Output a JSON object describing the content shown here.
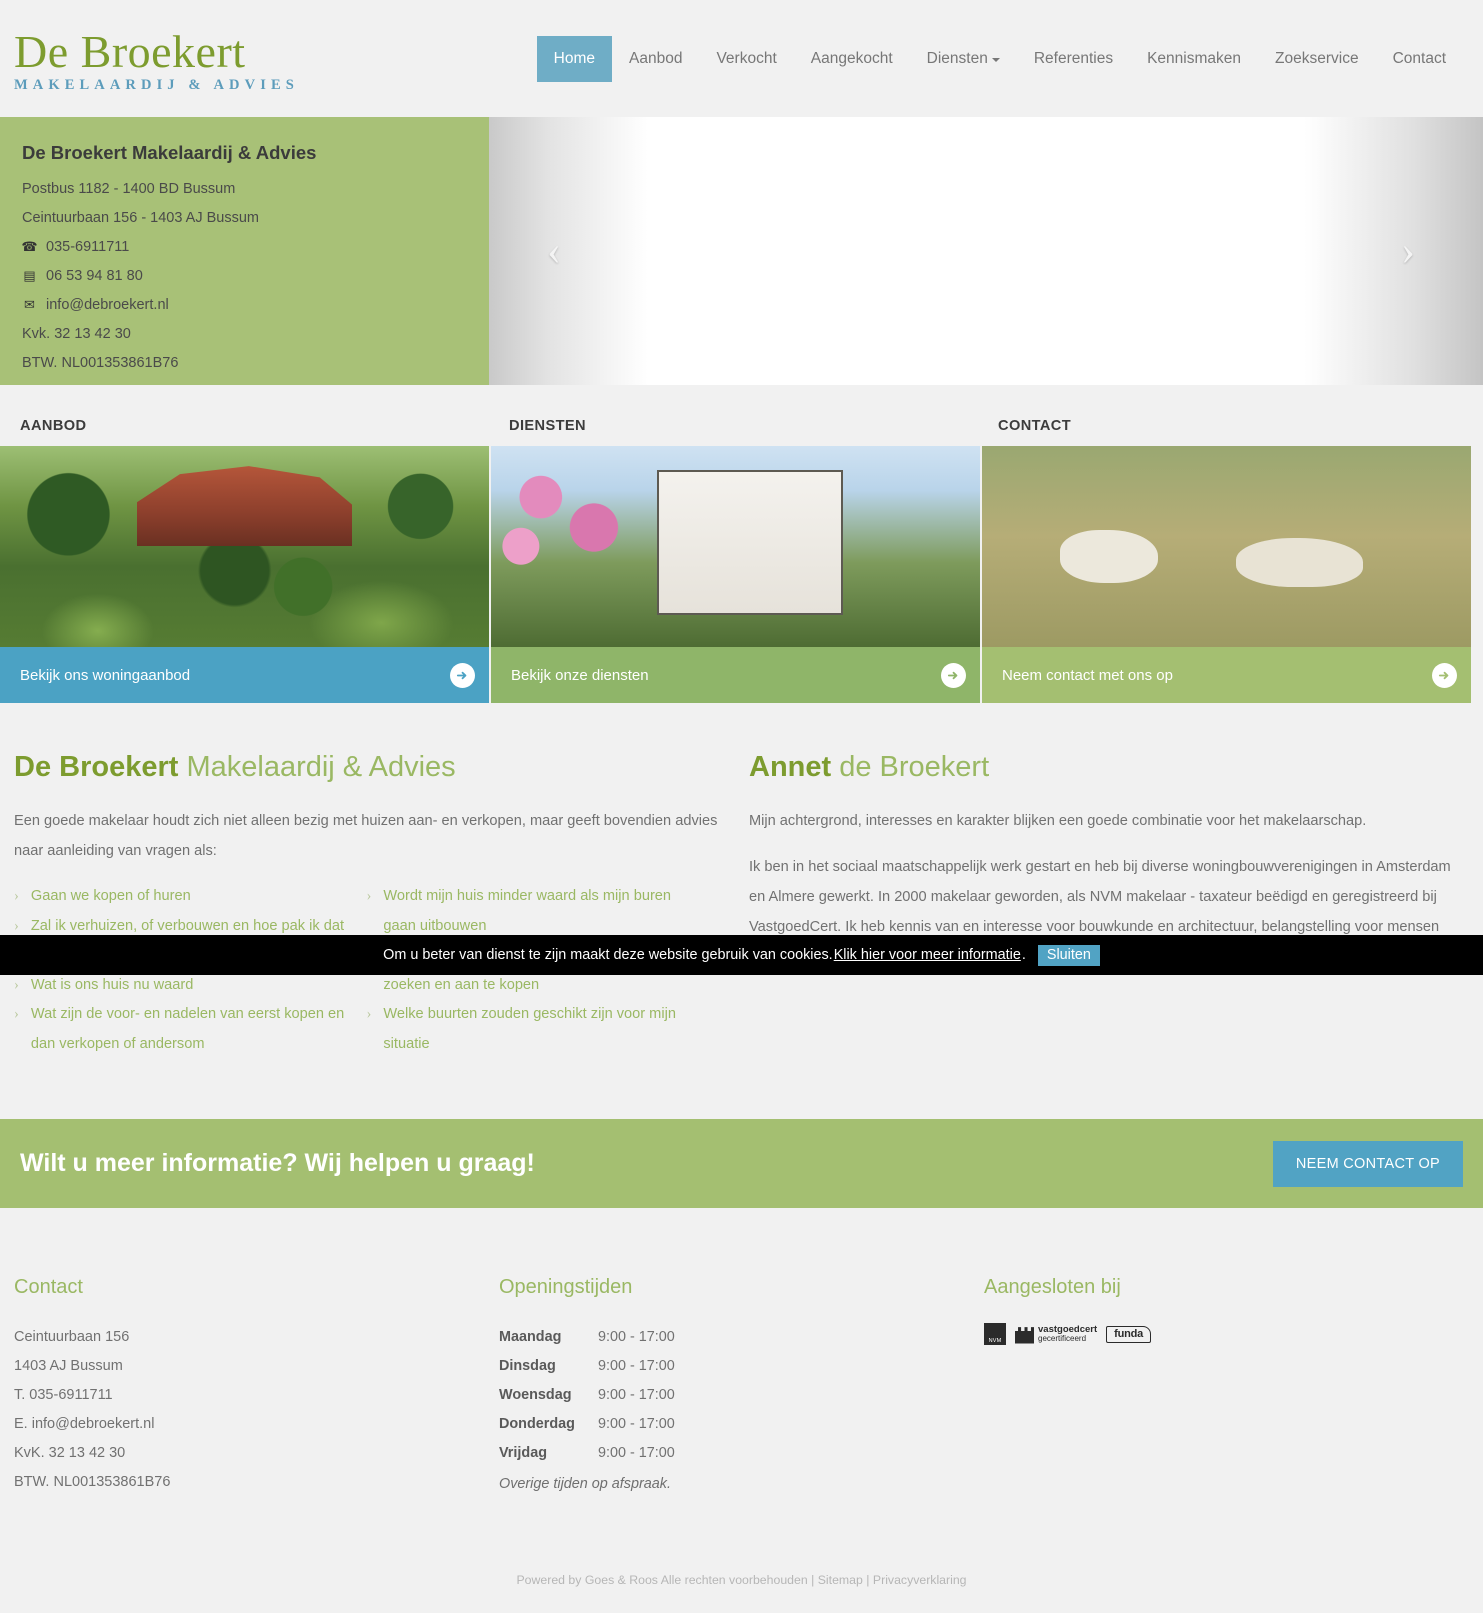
{
  "brand": {
    "name": "De Broekert",
    "tagline": "MAKELAARDIJ & ADVIES",
    "accent_green": "#7d9c2f",
    "accent_blue": "#5c9cbb"
  },
  "nav": {
    "items": [
      {
        "label": "Home",
        "active": true,
        "dropdown": false
      },
      {
        "label": "Aanbod",
        "active": false,
        "dropdown": false
      },
      {
        "label": "Verkocht",
        "active": false,
        "dropdown": false
      },
      {
        "label": "Aangekocht",
        "active": false,
        "dropdown": false
      },
      {
        "label": "Diensten",
        "active": false,
        "dropdown": true
      },
      {
        "label": "Referenties",
        "active": false,
        "dropdown": false
      },
      {
        "label": "Kennismaken",
        "active": false,
        "dropdown": false
      },
      {
        "label": "Zoekservice",
        "active": false,
        "dropdown": false
      },
      {
        "label": "Contact",
        "active": false,
        "dropdown": false
      }
    ]
  },
  "hero": {
    "company": "De Broekert Makelaardij & Advies",
    "address_postbus": "Postbus 1182 - 1400 BD Bussum",
    "address_street": "Ceintuurbaan 156 - 1403 AJ Bussum",
    "phone": "035-6911711",
    "mobile": "06 53 94 81 80",
    "email": "info@debroekert.nl",
    "kvk": "Kvk. 32 13 42 30",
    "btw": "BTW. NL001353861B76",
    "prev_arrow": "‹",
    "next_arrow": "›"
  },
  "promos": [
    {
      "heading": "AANBOD",
      "bar_label": "Bekijk ons woningaanbod",
      "color": "#4ba2c4"
    },
    {
      "heading": "DIENSTEN",
      "bar_label": "Bekijk onze diensten",
      "color": "#8fb569"
    },
    {
      "heading": "CONTACT",
      "bar_label": "Neem contact met ons op",
      "color": "#a4bf71"
    }
  ],
  "content": {
    "left": {
      "title_bold": "De Broekert",
      "title_rest": " Makelaardij & Advies",
      "intro": "Een goede makelaar houdt zich niet alleen bezig met huizen aan- en verkopen, maar geeft bovendien advies naar aanleiding van vragen als:",
      "questions_col1": [
        "Gaan we kopen of huren",
        "Zal ik verhuizen, of verbouwen en hoe pak ik dat aan",
        "Wat is ons huis nu waard",
        "Wat zijn de voor- en nadelen van eerst kopen en dan verkopen of andersom"
      ],
      "questions_col2": [
        "Wordt mijn huis minder waard als mijn buren gaan uitbouwen",
        "Hoe pak ik het aan om een geschikte woning te zoeken en aan te kopen",
        "Welke buurten zouden geschikt zijn voor mijn situatie"
      ]
    },
    "right": {
      "title_bold": "Annet",
      "title_rest": " de Broekert",
      "paragraph1": "Mijn achtergrond, interesses en karakter blijken een goede combinatie voor het makelaarschap.",
      "paragraph2": "Ik ben in het sociaal maatschappelijk werk gestart en heb bij diverse woningbouwverenigingen in Amsterdam en Almere gewerkt. In 2000 makelaar geworden, als NVM makelaar - taxateur beëdigd en geregistreerd bij VastgoedCert. Ik heb kennis van en interesse voor bouwkunde en architectuur, belangstelling voor mensen en"
    }
  },
  "cta": {
    "text": "Wilt u meer informatie? Wij helpen u graag!",
    "button": "NEEM CONTACT OP"
  },
  "footer": {
    "contact": {
      "title": "Contact",
      "lines": [
        "Ceintuurbaan 156",
        "1403 AJ Bussum",
        "T. 035-6911711",
        "E. info@debroekert.nl",
        "KvK. 32 13 42 30",
        "BTW. NL001353861B76"
      ]
    },
    "hours": {
      "title": "Openingstijden",
      "rows": [
        {
          "day": "Maandag",
          "time": "9:00 - 17:00"
        },
        {
          "day": "Dinsdag",
          "time": "9:00 - 17:00"
        },
        {
          "day": "Woensdag",
          "time": "9:00 - 17:00"
        },
        {
          "day": "Donderdag",
          "time": "9:00 - 17:00"
        },
        {
          "day": "Vrijdag",
          "time": "9:00 - 17:00"
        }
      ],
      "note": "Overige tijden op afspraak."
    },
    "affiliations": {
      "title": "Aangesloten bij",
      "nvm": "NVM",
      "vastgoedcert_line1": "vastgoedcert",
      "vastgoedcert_line2": "gecertificeerd",
      "funda": "funda"
    },
    "bottom": {
      "powered": "Powered by Goes & Roos Alle rechten voorbehouden",
      "sep1": "|",
      "sitemap": "Sitemap",
      "sep2": "|",
      "privacy": "Privacyverklaring"
    }
  },
  "cookie": {
    "text": "Om u beter van dienst te zijn maakt deze website gebruik van cookies.",
    "link": "Klik hier voor meer informatie",
    "period": ".",
    "button": "Sluiten"
  }
}
